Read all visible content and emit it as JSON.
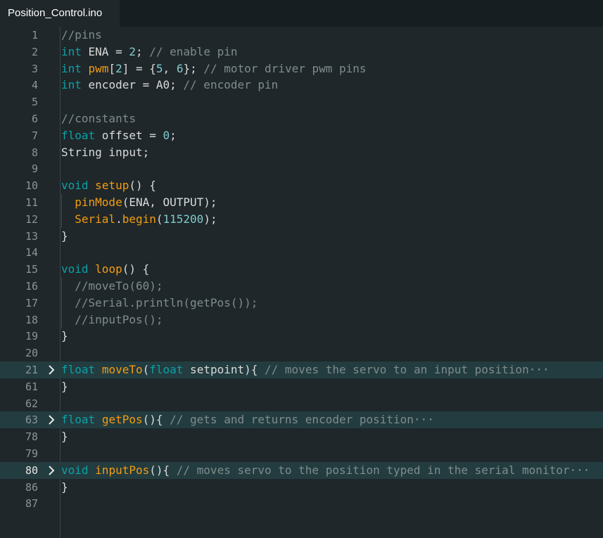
{
  "tab": {
    "title": "Position_Control.ino"
  },
  "lines": [
    {
      "n": "1",
      "tokens": [
        [
          "cm",
          "//pins"
        ]
      ]
    },
    {
      "n": "2",
      "tokens": [
        [
          "kw",
          "int"
        ],
        [
          "pl",
          " ENA = "
        ],
        [
          "num",
          "2"
        ],
        [
          "pl",
          "; "
        ],
        [
          "cm",
          "// enable pin"
        ]
      ]
    },
    {
      "n": "3",
      "tokens": [
        [
          "kw",
          "int"
        ],
        [
          "pl",
          " "
        ],
        [
          "fn",
          "pwm"
        ],
        [
          "pl",
          "["
        ],
        [
          "num",
          "2"
        ],
        [
          "pl",
          "] = {"
        ],
        [
          "num",
          "5"
        ],
        [
          "pl",
          ", "
        ],
        [
          "num",
          "6"
        ],
        [
          "pl",
          "}; "
        ],
        [
          "cm",
          "// motor driver pwm pins"
        ]
      ]
    },
    {
      "n": "4",
      "tokens": [
        [
          "kw",
          "int"
        ],
        [
          "pl",
          " encoder = A0; "
        ],
        [
          "cm",
          "// encoder pin"
        ]
      ]
    },
    {
      "n": "5",
      "tokens": []
    },
    {
      "n": "6",
      "tokens": [
        [
          "cm",
          "//constants"
        ]
      ]
    },
    {
      "n": "7",
      "tokens": [
        [
          "kw",
          "float"
        ],
        [
          "pl",
          " offset = "
        ],
        [
          "num",
          "0"
        ],
        [
          "pl",
          ";"
        ]
      ]
    },
    {
      "n": "8",
      "tokens": [
        [
          "pl",
          "String input;"
        ]
      ]
    },
    {
      "n": "9",
      "tokens": []
    },
    {
      "n": "10",
      "tokens": [
        [
          "kw",
          "void"
        ],
        [
          "pl",
          " "
        ],
        [
          "fn",
          "setup"
        ],
        [
          "pl",
          "() {"
        ]
      ]
    },
    {
      "n": "11",
      "guide": true,
      "tokens": [
        [
          "pl",
          "  "
        ],
        [
          "fn",
          "pinMode"
        ],
        [
          "pl",
          "(ENA, OUTPUT);"
        ]
      ]
    },
    {
      "n": "12",
      "guide": true,
      "tokens": [
        [
          "pl",
          "  "
        ],
        [
          "fn",
          "Serial"
        ],
        [
          "pl",
          "."
        ],
        [
          "fn",
          "begin"
        ],
        [
          "pl",
          "("
        ],
        [
          "num",
          "115200"
        ],
        [
          "pl",
          ");"
        ]
      ]
    },
    {
      "n": "13",
      "tokens": [
        [
          "pl",
          "}"
        ]
      ]
    },
    {
      "n": "14",
      "tokens": []
    },
    {
      "n": "15",
      "tokens": [
        [
          "kw",
          "void"
        ],
        [
          "pl",
          " "
        ],
        [
          "fn",
          "loop"
        ],
        [
          "pl",
          "() {"
        ]
      ]
    },
    {
      "n": "16",
      "guide": true,
      "tokens": [
        [
          "pl",
          "  "
        ],
        [
          "cm",
          "//moveTo(60);"
        ]
      ]
    },
    {
      "n": "17",
      "guide": true,
      "tokens": [
        [
          "pl",
          "  "
        ],
        [
          "cm",
          "//Serial.println(getPos());"
        ]
      ]
    },
    {
      "n": "18",
      "guide": true,
      "tokens": [
        [
          "pl",
          "  "
        ],
        [
          "cm",
          "//inputPos();"
        ]
      ]
    },
    {
      "n": "19",
      "tokens": [
        [
          "pl",
          "}"
        ]
      ]
    },
    {
      "n": "20",
      "tokens": []
    },
    {
      "n": "21",
      "fold": true,
      "tokens": [
        [
          "kw",
          "float"
        ],
        [
          "pl",
          " "
        ],
        [
          "fn",
          "moveTo"
        ],
        [
          "pl",
          "("
        ],
        [
          "kw",
          "float"
        ],
        [
          "pl",
          " setpoint){ "
        ],
        [
          "cm",
          "// moves the servo to an input position"
        ]
      ]
    },
    {
      "n": "61",
      "tokens": [
        [
          "pl",
          "}"
        ]
      ]
    },
    {
      "n": "62",
      "tokens": []
    },
    {
      "n": "63",
      "fold": true,
      "tokens": [
        [
          "kw",
          "float"
        ],
        [
          "pl",
          " "
        ],
        [
          "fn",
          "getPos"
        ],
        [
          "pl",
          "(){ "
        ],
        [
          "cm",
          "// gets and returns encoder position"
        ]
      ]
    },
    {
      "n": "78",
      "tokens": [
        [
          "pl",
          "}"
        ]
      ]
    },
    {
      "n": "79",
      "tokens": []
    },
    {
      "n": "80",
      "fold": true,
      "active": true,
      "tokens": [
        [
          "kw",
          "void"
        ],
        [
          "pl",
          " "
        ],
        [
          "fn",
          "inputPos"
        ],
        [
          "pl",
          "(){ "
        ],
        [
          "cm",
          "// moves servo to the position typed in the serial monitor"
        ]
      ]
    },
    {
      "n": "86",
      "tokens": [
        [
          "pl",
          "}"
        ]
      ]
    },
    {
      "n": "87",
      "tokens": []
    }
  ],
  "ellipsis": "···",
  "icons": {
    "fold": "chevron-right-icon"
  },
  "colors": {
    "background": "#1f272a",
    "keyword": "#0ca1a6",
    "function": "#f39c12",
    "number": "#7fcbcd",
    "comment": "#7f8c8d",
    "text": "#dadada",
    "fold_highlight": "#233c40"
  }
}
